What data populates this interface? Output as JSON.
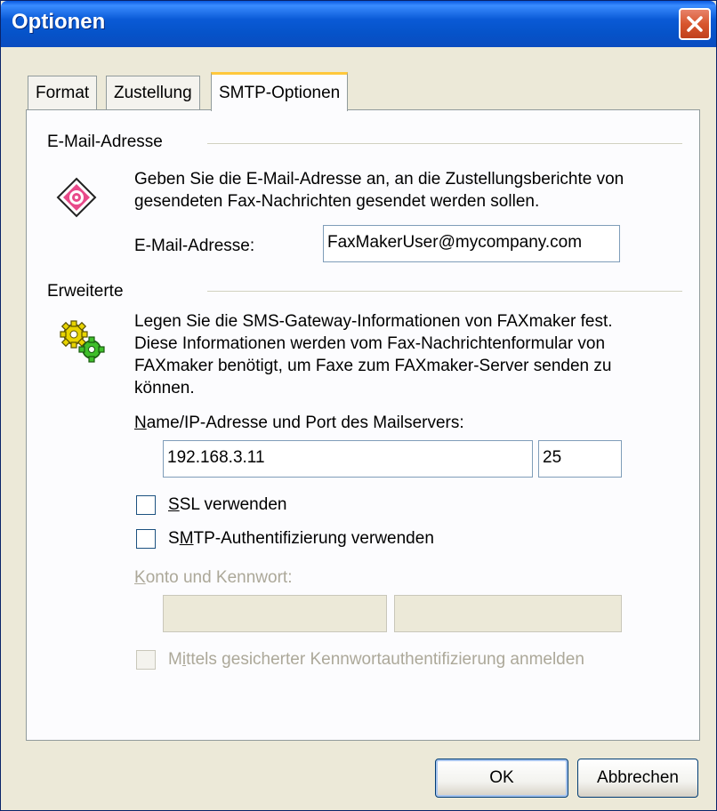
{
  "window": {
    "title": "Optionen"
  },
  "tabs": [
    {
      "label": "Format",
      "active": false
    },
    {
      "label": "Zustellung",
      "active": false
    },
    {
      "label": "SMTP-Optionen",
      "active": true
    }
  ],
  "email_section": {
    "heading": "E-Mail-Adresse",
    "description_line1": "Geben Sie die E-Mail-Adresse an, an die Zustellungsberichte von",
    "description_line2": "gesendeten Fax-Nachrichten gesendet werden sollen.",
    "field_label": "E-Mail-Adresse:",
    "field_value": "FaxMakerUser@mycompany.com",
    "icon": "email-target-icon"
  },
  "advanced_section": {
    "heading": "Erweiterte",
    "description_line1": "Legen Sie die SMS-Gateway-Informationen von FAXmaker fest.",
    "description_line2": "Diese Informationen werden vom Fax-Nachrichtenformular von",
    "description_line3": "FAXmaker benötigt, um Faxe zum FAXmaker-Server senden zu",
    "description_line4": "können.",
    "icon": "gears-icon",
    "server_label_mnemonic": "N",
    "server_label_rest": "ame/IP-Adresse und Port des Mailservers:",
    "server_value": "192.168.3.11",
    "port_value": "25",
    "ssl": {
      "mnemonic": "S",
      "rest": "SL verwenden",
      "checked": false
    },
    "smtp_auth": {
      "pre": "S",
      "mnemonic": "M",
      "rest": "TP-Authentifizierung verwenden",
      "checked": false
    },
    "account_label_mnemonic": "K",
    "account_label_rest": "onto und Kennwort:",
    "account_value": "",
    "password_value": "",
    "spa": {
      "pre": "M",
      "mnemonic": "i",
      "rest": "ttels gesicherter Kennwortauthentifizierung anmelden",
      "checked": false,
      "disabled": true
    }
  },
  "buttons": {
    "ok": "OK",
    "cancel": "Abbrechen"
  },
  "colors": {
    "titlebar": "#0a5ad6",
    "close": "#d8562e",
    "dialog_bg": "#ece9d8",
    "active_tab_accent": "#ffc83c"
  }
}
